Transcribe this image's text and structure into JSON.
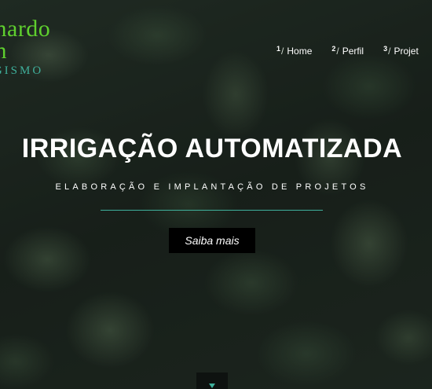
{
  "logo": {
    "line1": "onardo",
    "line2": "nn",
    "line3": "AGISMO",
    "colors": {
      "name": "#5fcf2e",
      "tagline": "#3fae9a"
    }
  },
  "nav": {
    "items": [
      {
        "num": "1",
        "label": "Home"
      },
      {
        "num": "2",
        "label": "Perfil"
      },
      {
        "num": "3",
        "label": "Projet"
      }
    ]
  },
  "hero": {
    "title": "IRRIGAÇÃO AUTOMATIZADA",
    "subtitle": "ELABORAÇÃO E IMPLANTAÇÃO DE PROJETOS",
    "cta_label": "Saiba mais",
    "accent": "#3fb09c"
  },
  "scroll_button": {
    "icon": "chevron-down-icon",
    "color": "#3fb09c"
  }
}
